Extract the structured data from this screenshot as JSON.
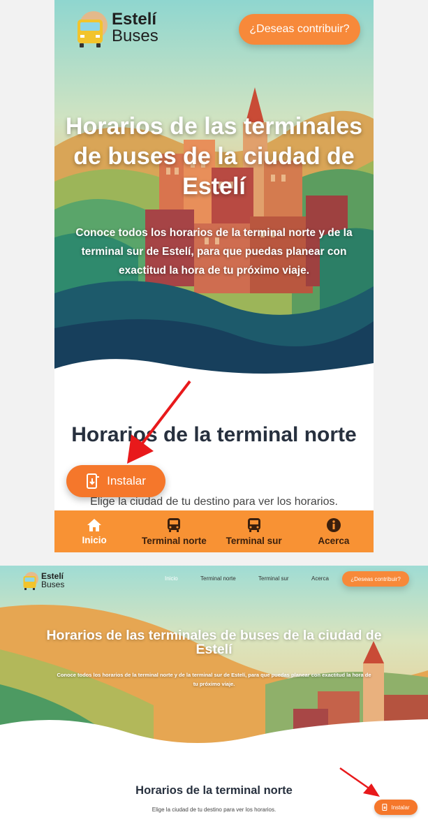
{
  "colors": {
    "accent": "#f7893a",
    "nav_bg": "#f89234",
    "heading": "#27303e",
    "arrow": "#e8191b"
  },
  "brand": {
    "line1": "Estelí",
    "line2": "Buses"
  },
  "cta_label": "¿Deseas contribuir?",
  "hero": {
    "title_mobile": "Horarios de las terminales de buses de la ciudad de Estelí",
    "title_desktop": "Horarios de las terminales de buses de la ciudad de Estelí",
    "subtitle": "Conoce todos los horarios de la terminal norte y de la terminal sur de Estelí, para que puedas planear con exactitud la hora de tu próximo viaje."
  },
  "section": {
    "title": "Horarios de la terminal norte",
    "subtitle": "Elige la ciudad de tu destino para ver los horarios."
  },
  "install_label": "Instalar",
  "nav": [
    {
      "label": "Inicio",
      "icon": "home-icon"
    },
    {
      "label": "Terminal norte",
      "icon": "bus-icon"
    },
    {
      "label": "Terminal sur",
      "icon": "bus-icon"
    },
    {
      "label": "Acerca",
      "icon": "info-icon"
    }
  ]
}
